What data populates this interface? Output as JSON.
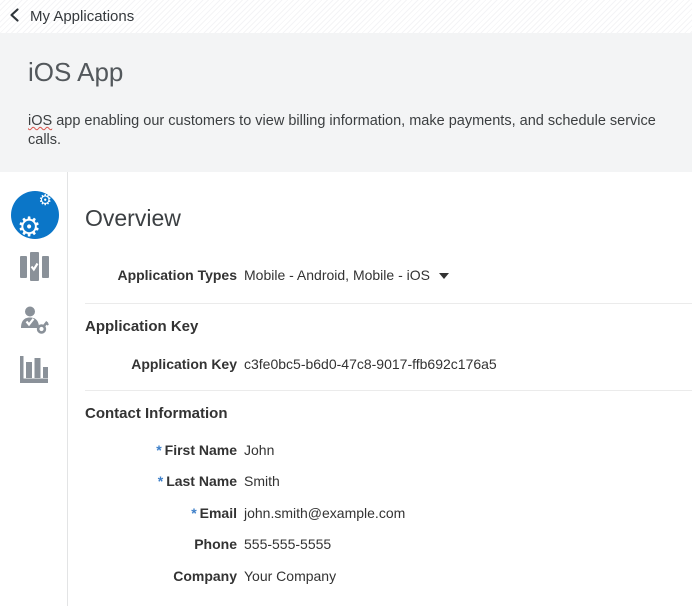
{
  "topbar": {
    "back_icon": "chevron-left",
    "title": "My Applications"
  },
  "header": {
    "app_name": "iOS App",
    "description_word1": "iOS",
    "description_rest": " app enabling our customers to view billing information, make payments, and schedule service calls."
  },
  "sidebar": {
    "items": [
      {
        "icon": "gears-icon",
        "name": "settings",
        "active": true
      },
      {
        "icon": "bars-check-icon",
        "name": "validation",
        "active": false
      },
      {
        "icon": "user-key-icon",
        "name": "user-security",
        "active": false
      },
      {
        "icon": "bar-chart-icon",
        "name": "analytics",
        "active": false
      }
    ]
  },
  "main": {
    "title": "Overview",
    "application_types": {
      "label": "Application Types",
      "value": "Mobile - Android, Mobile - iOS",
      "dropdown_icon": "caret-down-icon"
    },
    "required_marker": "*",
    "sections": [
      {
        "title": "Application Key",
        "fields": [
          {
            "label": "Application Key",
            "value": "c3fe0bc5-b6d0-47c8-9017-ffb692c176a5",
            "required": false
          }
        ]
      },
      {
        "title": "Contact Information",
        "fields": [
          {
            "label": "First Name",
            "value": "John",
            "required": true
          },
          {
            "label": "Last Name",
            "value": "Smith",
            "required": true
          },
          {
            "label": "Email",
            "value": "john.smith@example.com",
            "required": true
          },
          {
            "label": "Phone",
            "value": "555-555-5555",
            "required": false
          },
          {
            "label": "Company",
            "value": "Your Company",
            "required": false
          }
        ]
      }
    ]
  },
  "colors": {
    "accent_blue": "#0b76c8",
    "icon_gray": "#8a9199",
    "required_asterisk": "#3d7fc9",
    "header_bg": "#f3f4f5"
  }
}
